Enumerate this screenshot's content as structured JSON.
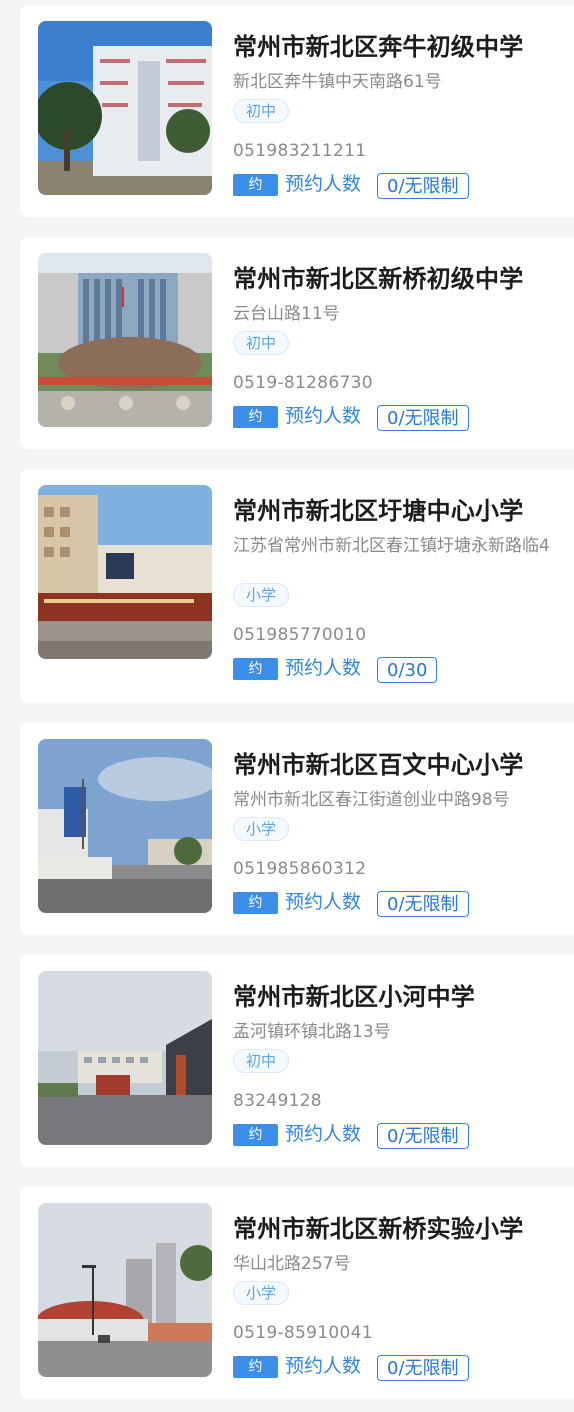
{
  "schools": [
    {
      "name": "常州市新北区奔牛初级中学",
      "address": "新北区奔牛镇中天南路61号",
      "level": "初中",
      "phone": "051983211211",
      "badge": "约",
      "booking_label": "预约人数",
      "quota": "0/无限制"
    },
    {
      "name": "常州市新北区新桥初级中学",
      "address": "云台山路11号",
      "level": "初中",
      "phone": "0519-81286730",
      "badge": "约",
      "booking_label": "预约人数",
      "quota": "0/无限制"
    },
    {
      "name": "常州市新北区圩塘中心小学",
      "address": "江苏省常州市新北区春江镇圩塘永新路临4",
      "level": "小学",
      "phone": "051985770010",
      "badge": "约",
      "booking_label": "预约人数",
      "quota": "0/30"
    },
    {
      "name": "常州市新北区百文中心小学",
      "address": "常州市新北区春江街道创业中路98号",
      "level": "小学",
      "phone": "051985860312",
      "badge": "约",
      "booking_label": "预约人数",
      "quota": "0/无限制"
    },
    {
      "name": "常州市新北区小河中学",
      "address": "孟河镇环镇北路13号",
      "level": "初中",
      "phone": "83249128",
      "badge": "约",
      "booking_label": "预约人数",
      "quota": "0/无限制"
    },
    {
      "name": "常州市新北区新桥实验小学",
      "address": "华山北路257号",
      "level": "小学",
      "phone": "0519-85910041",
      "badge": "约",
      "booking_label": "预约人数",
      "quota": "0/无限制"
    }
  ],
  "colors": {
    "accent": "#2f86e6",
    "badge_bg": "#3c8fe8",
    "tag_text": "#5aa4e8",
    "title": "#1c1c1c",
    "muted": "#8a8a8a",
    "page_bg": "#f4f4f4"
  }
}
